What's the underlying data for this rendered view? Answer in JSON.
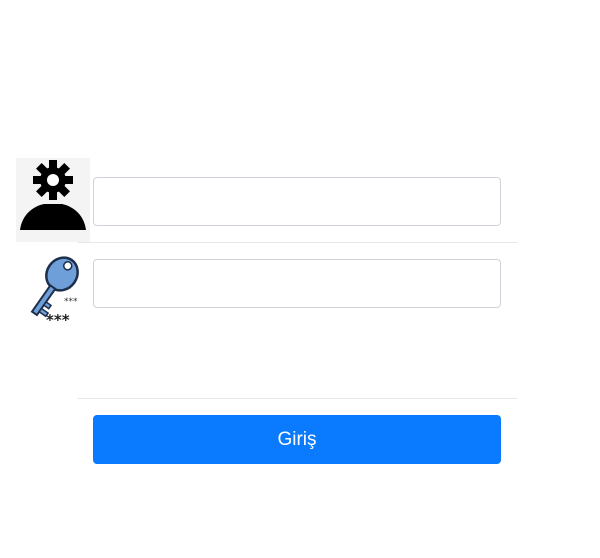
{
  "login_form": {
    "username": {
      "icon": "user-gear-icon",
      "value": "",
      "placeholder": ""
    },
    "password": {
      "icon": "key-password-icon",
      "value": "",
      "placeholder": ""
    },
    "submit_label": "Giriş"
  },
  "colors": {
    "button_bg": "#0a7bff",
    "button_text": "#ffffff",
    "key_blue": "#6f9fd8",
    "field_border": "#ced4da"
  }
}
